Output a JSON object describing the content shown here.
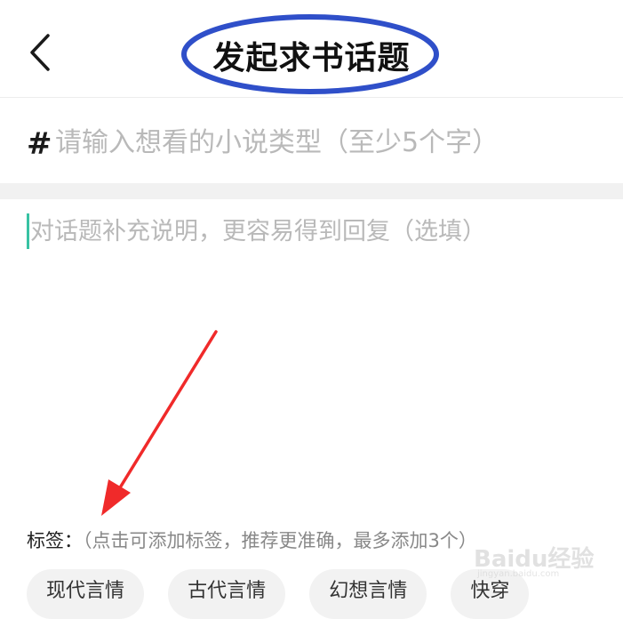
{
  "header": {
    "title": "发起求书话题",
    "back_icon": "chevron-left-icon"
  },
  "topic": {
    "hash_symbol": "#",
    "placeholder": "请输入想看的小说类型（至少5个字）"
  },
  "description": {
    "placeholder": "对话题补充说明，更容易得到回复（选填）"
  },
  "tags": {
    "label": "标签：",
    "hint": "（点击可添加标签，推荐更准确，最多添加3个）",
    "items": [
      "现代言情",
      "古代言情",
      "幻想言情",
      "快穿"
    ]
  },
  "watermark": {
    "logo": "Baidu经验",
    "sub": "jingyan.baidu.com"
  },
  "colors": {
    "annotation_ellipse": "#2f4fc9",
    "annotation_arrow": "#f02a2a",
    "caret": "#38c2a3",
    "placeholder": "#b9b9b9"
  }
}
